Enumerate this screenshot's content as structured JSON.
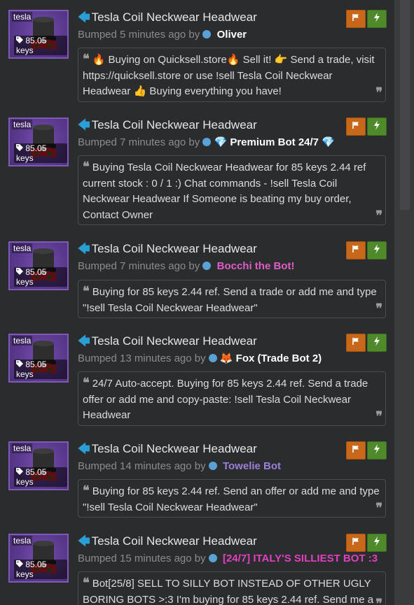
{
  "listings": [
    {
      "thumb_tag": "tesla",
      "price": "85.05 keys",
      "title": "Tesla Coil Neckwear Headwear",
      "bumped_text": "Bumped 5 minutes ago by",
      "user": "Oliver",
      "user_color": "#ffffff",
      "user_prefix": "",
      "user_suffix": "",
      "message": "🔥 Buying on Quicksell.store🔥  Sell it! 👉 Send a trade, visit https://quicksell.store or use !sell Tesla Coil Neckwear Headwear 👍 Buying everything you have!"
    },
    {
      "thumb_tag": "tesla",
      "price": "85.05 keys",
      "title": "Tesla Coil Neckwear Headwear",
      "bumped_text": "Bumped 7 minutes ago by",
      "user": "Premium Bot 24/7",
      "user_color": "#ffffff",
      "user_prefix": "💎",
      "user_suffix": "💎",
      "message": "Buying Tesla Coil Neckwear Headwear for 85 keys 2.44 ref current stock : 0 / 1 :) Chat commands - !sell Tesla Coil Neckwear Headwear If Someone is beating my buy order, Contact Owner"
    },
    {
      "thumb_tag": "tesla",
      "price": "85.05 keys",
      "title": "Tesla Coil Neckwear Headwear",
      "bumped_text": "Bumped 7 minutes ago by",
      "user": "Bocchi the Bot!",
      "user_color": "#e05cc7",
      "user_prefix": "",
      "user_suffix": "",
      "message": "Buying for 85 keys 2.44 ref. Send a trade or add me and type \"!sell Tesla Coil Neckwear Headwear\""
    },
    {
      "thumb_tag": "tesla",
      "price": "85.05 keys",
      "title": "Tesla Coil Neckwear Headwear",
      "bumped_text": "Bumped 13 minutes ago by",
      "user": "Fox (Trade Bot 2)",
      "user_color": "#ffffff",
      "user_prefix": "🦊",
      "user_suffix": "",
      "message": "24/7 Auto-accept. Buying for 85 keys 2.44 ref. Send a trade offer or add me and copy-paste: !sell Tesla Coil Neckwear Headwear"
    },
    {
      "thumb_tag": "tesla",
      "price": "85.05 keys",
      "title": "Tesla Coil Neckwear Headwear",
      "bumped_text": "Bumped 14 minutes ago by",
      "user": "Towelie Bot",
      "user_color": "#9b7fd9",
      "user_prefix": "",
      "user_suffix": "",
      "message": "Buying for 85 keys 2.44 ref. Send an offer or add me and type \"!sell Tesla Coil Neckwear Headwear\""
    },
    {
      "thumb_tag": "tesla",
      "price": "85.05 keys",
      "title": "Tesla Coil Neckwear Headwear",
      "bumped_text": "Bumped 15 minutes ago by",
      "user": "[24/7] ITALY'S SILLIEST BOT :3",
      "user_color": "#e040c0",
      "user_prefix": "",
      "user_suffix": "",
      "message": "Bot[25/8] SELL TO SILLY BOT INSTEAD OF OTHER UGLY BORING BOTS >:3 I'm buying for 85 keys 2.44 ref. Send me a"
    }
  ],
  "colors": {
    "background": "#2b2c2e",
    "flag_button": "#c6671a",
    "bolt_button": "#4e8a2a",
    "arrow": "#2a9fd6",
    "status_dot": "#5aa2d6"
  },
  "icons": {
    "flag_button": "flag-icon",
    "bolt_button": "lightning-icon",
    "arrow": "arrow-left-icon",
    "price_tag": "tag-icon",
    "quote": "quote-icon"
  }
}
